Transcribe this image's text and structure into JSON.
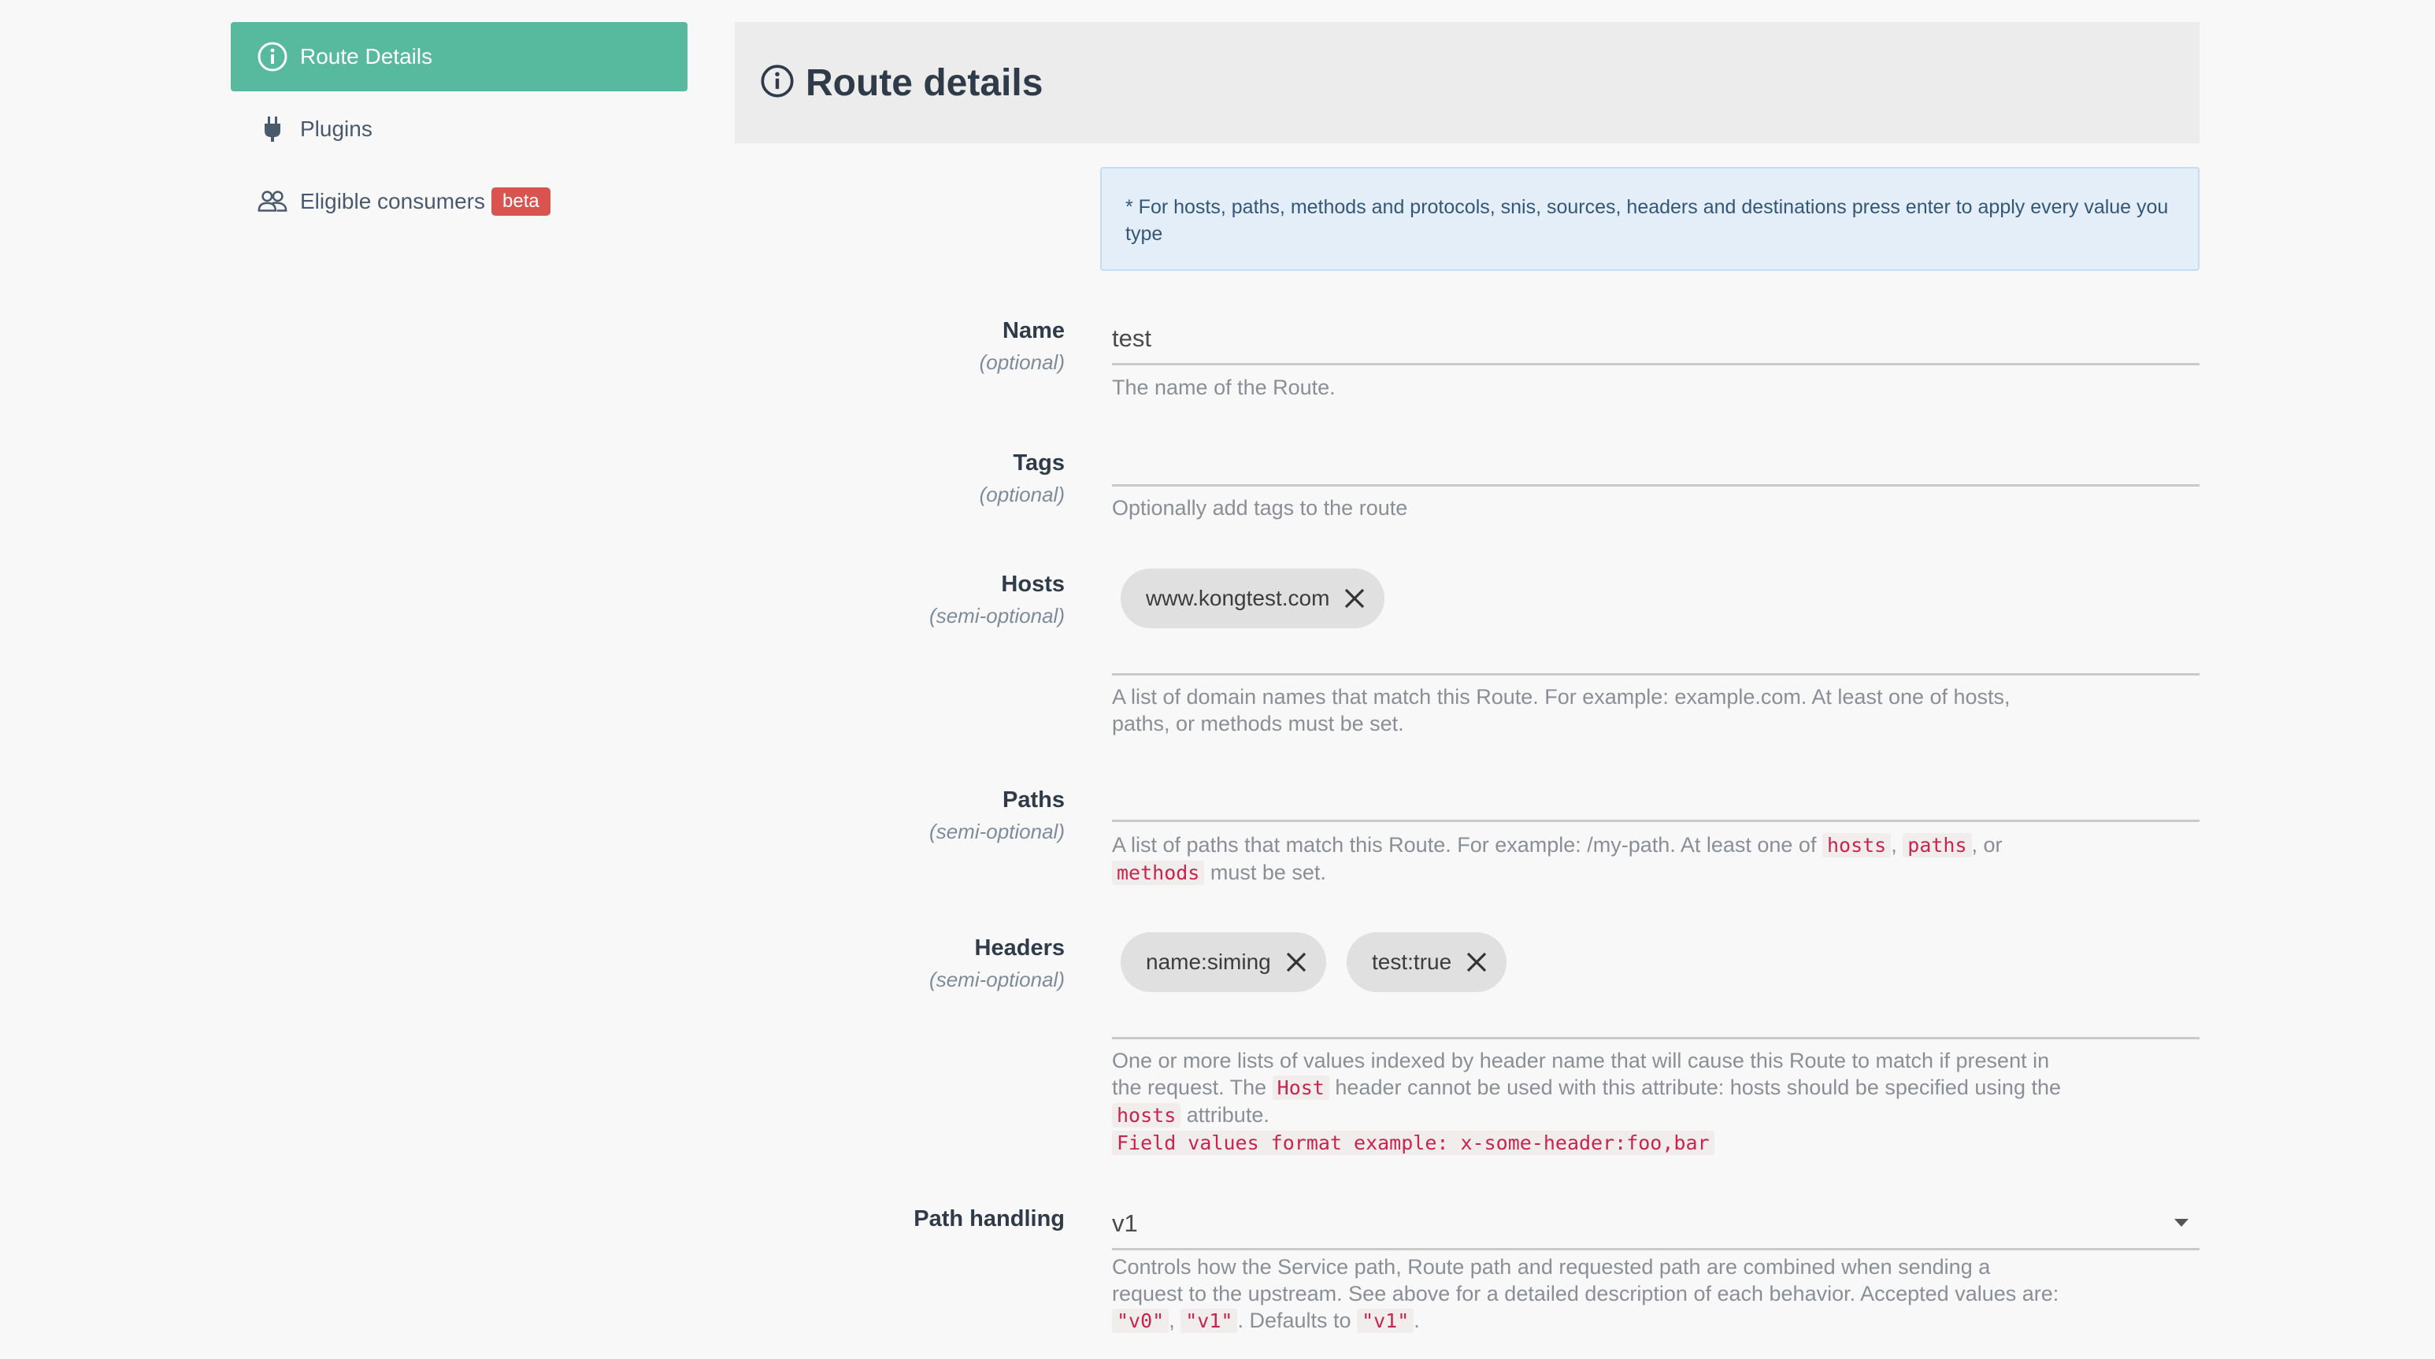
{
  "sidebar": {
    "items": [
      {
        "label": "Route Details",
        "icon": "info-icon",
        "active": true
      },
      {
        "label": "Plugins",
        "icon": "plug-icon",
        "active": false
      },
      {
        "label": "Eligible consumers",
        "icon": "users-icon",
        "active": false,
        "badge": "beta"
      }
    ]
  },
  "header": {
    "title": "Route details",
    "icon": "info-icon"
  },
  "info": {
    "text": "* For hosts, paths, methods and protocols, snis, sources, headers and destinations press enter to apply every value you type"
  },
  "form": {
    "name": {
      "label": "Name",
      "sub": "(optional)",
      "value": "test",
      "help": "The name of the Route."
    },
    "tags": {
      "label": "Tags",
      "sub": "(optional)",
      "value": "",
      "help": "Optionally add tags to the route"
    },
    "hosts": {
      "label": "Hosts",
      "sub": "(semi-optional)",
      "chips": [
        "www.kongtest.com"
      ],
      "help_line1": "A list of domain names that match this Route. For example: example.com. At least one of hosts,",
      "help_line2": "paths, or methods must be set."
    },
    "paths": {
      "label": "Paths",
      "sub": "(semi-optional)",
      "help_a": "A list of paths that match this Route. For example: /my-path. At least one of",
      "code_hosts": "hosts",
      "comma": ",",
      "code_paths": "paths",
      "or": ", or",
      "code_methods": "methods",
      "help_b": "must be set."
    },
    "headers": {
      "label": "Headers",
      "sub": "(semi-optional)",
      "chips": [
        "name:siming",
        "test:true"
      ],
      "help_a": "One or more lists of values indexed by header name that will cause this Route to match if present in",
      "help_b": "the request. The",
      "code_host": "Host",
      "help_c": "header cannot be used with this attribute: hosts should be specified using the",
      "code_hosts": "hosts",
      "help_d": "attribute.",
      "code_example": "Field values format example: x-some-header:foo,bar"
    },
    "path_handling": {
      "label": "Path handling",
      "value": "v1",
      "help_a": "Controls how the Service path, Route path and requested path are combined when sending a",
      "help_b": "request to the upstream. See above for a detailed description of each behavior. Accepted values are:",
      "code_v0": "\"v0\"",
      "comma": ",",
      "code_v1": "\"v1\"",
      "help_c": ". Defaults to",
      "code_default": "\"v1\"",
      "period": "."
    }
  },
  "colors": {
    "accent": "#57b99d",
    "badge": "#d9534f",
    "code": "#c7254e"
  }
}
